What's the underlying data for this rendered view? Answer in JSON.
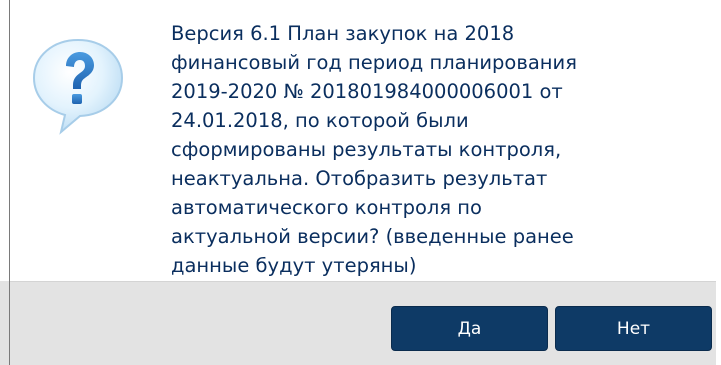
{
  "dialog": {
    "icon": "question-icon",
    "message": "Версия 6.1 План закупок на 2018\nфинансовый год период планирования\n2019-2020 № 201801984000006001 от\n24.01.2018, по которой были\nсформированы результаты контроля,\nнеактуальна. Отобразить результат\nавтоматического контроля по\nактуальной версии? (введенные ранее\nданные будут утеряны)",
    "yes_label": "Да",
    "no_label": "Нет"
  },
  "colors": {
    "button_bg": "#0e3a66",
    "text": "#0a2e5e",
    "icon_bubble": "#d4ecfb",
    "icon_mark": "#2f7fc8",
    "footer_bg": "#e3e3e3"
  }
}
